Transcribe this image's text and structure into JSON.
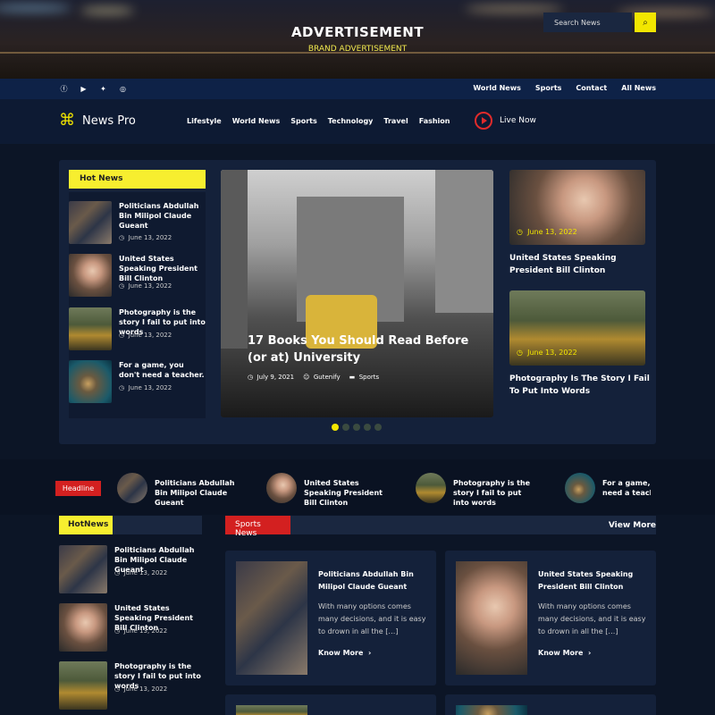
{
  "ad": {
    "title": "ADVERTISEMENT",
    "subtitle": "BRAND ADVERTISEMENT"
  },
  "topbar": {
    "social": [
      "facebook-icon",
      "youtube-icon",
      "twitter-icon",
      "instagram-icon"
    ],
    "links": [
      "World News",
      "Sports",
      "Contact",
      "All News"
    ]
  },
  "header": {
    "logo": "News Pro",
    "nav": [
      "Lifestyle",
      "World News",
      "Sports",
      "Technology",
      "Travel",
      "Fashion"
    ],
    "live": "Live Now",
    "search_placeholder": "Search News"
  },
  "hot_news": {
    "label": "Hot News",
    "items": [
      {
        "title": "Politicians Abdullah Bin Milipol Claude Gueant",
        "date": "June 13, 2022"
      },
      {
        "title": "United States Speaking President Bill Clinton",
        "date": "June 13, 2022"
      },
      {
        "title": "Photography is the story I fail to put into words",
        "date": "June 13, 2022"
      },
      {
        "title": "For a game, you don't need a teacher.",
        "date": "June 13, 2022"
      }
    ]
  },
  "featured": {
    "title": "17 Books You Should Read Before (or at) University",
    "date": "July 9, 2021",
    "author": "Gutenify",
    "category": "Sports",
    "slides": 5,
    "active_slide": 1
  },
  "side_cards": [
    {
      "date": "June 13, 2022",
      "title": "United States Speaking President Bill Clinton"
    },
    {
      "date": "June 13, 2022",
      "title": "Photography Is The Story I Fail To Put Into Words"
    }
  ],
  "headline": {
    "label": "Headline",
    "items": [
      "Politicians Abdullah Bin Milipol Claude Gueant",
      "United States Speaking President Bill Clinton",
      "Photography is the story I fail to put into words",
      "For a game, you don't need a teacher."
    ]
  },
  "hotnews2": {
    "label": "HotNews",
    "items": [
      {
        "title": "Politicians Abdullah Bin Milipol Claude Gueant",
        "date": "June 13, 2022"
      },
      {
        "title": "United States Speaking President Bill Clinton",
        "date": "June 13, 2022"
      },
      {
        "title": "Photography is the story I fail to put into words",
        "date": "June 13, 2022"
      }
    ]
  },
  "sports": {
    "label": "Sports News",
    "view_more": "View More",
    "cards": [
      {
        "title": "Politicians Abdullah Bin Milipol Claude Gueant",
        "excerpt": "With many options comes many decisions, and it is easy to drown in all the […]",
        "more": "Know More"
      },
      {
        "title": "United States Speaking President Bill Clinton",
        "excerpt": "With many options comes many decisions, and it is easy to drown in all the […]",
        "more": "Know More"
      }
    ]
  }
}
